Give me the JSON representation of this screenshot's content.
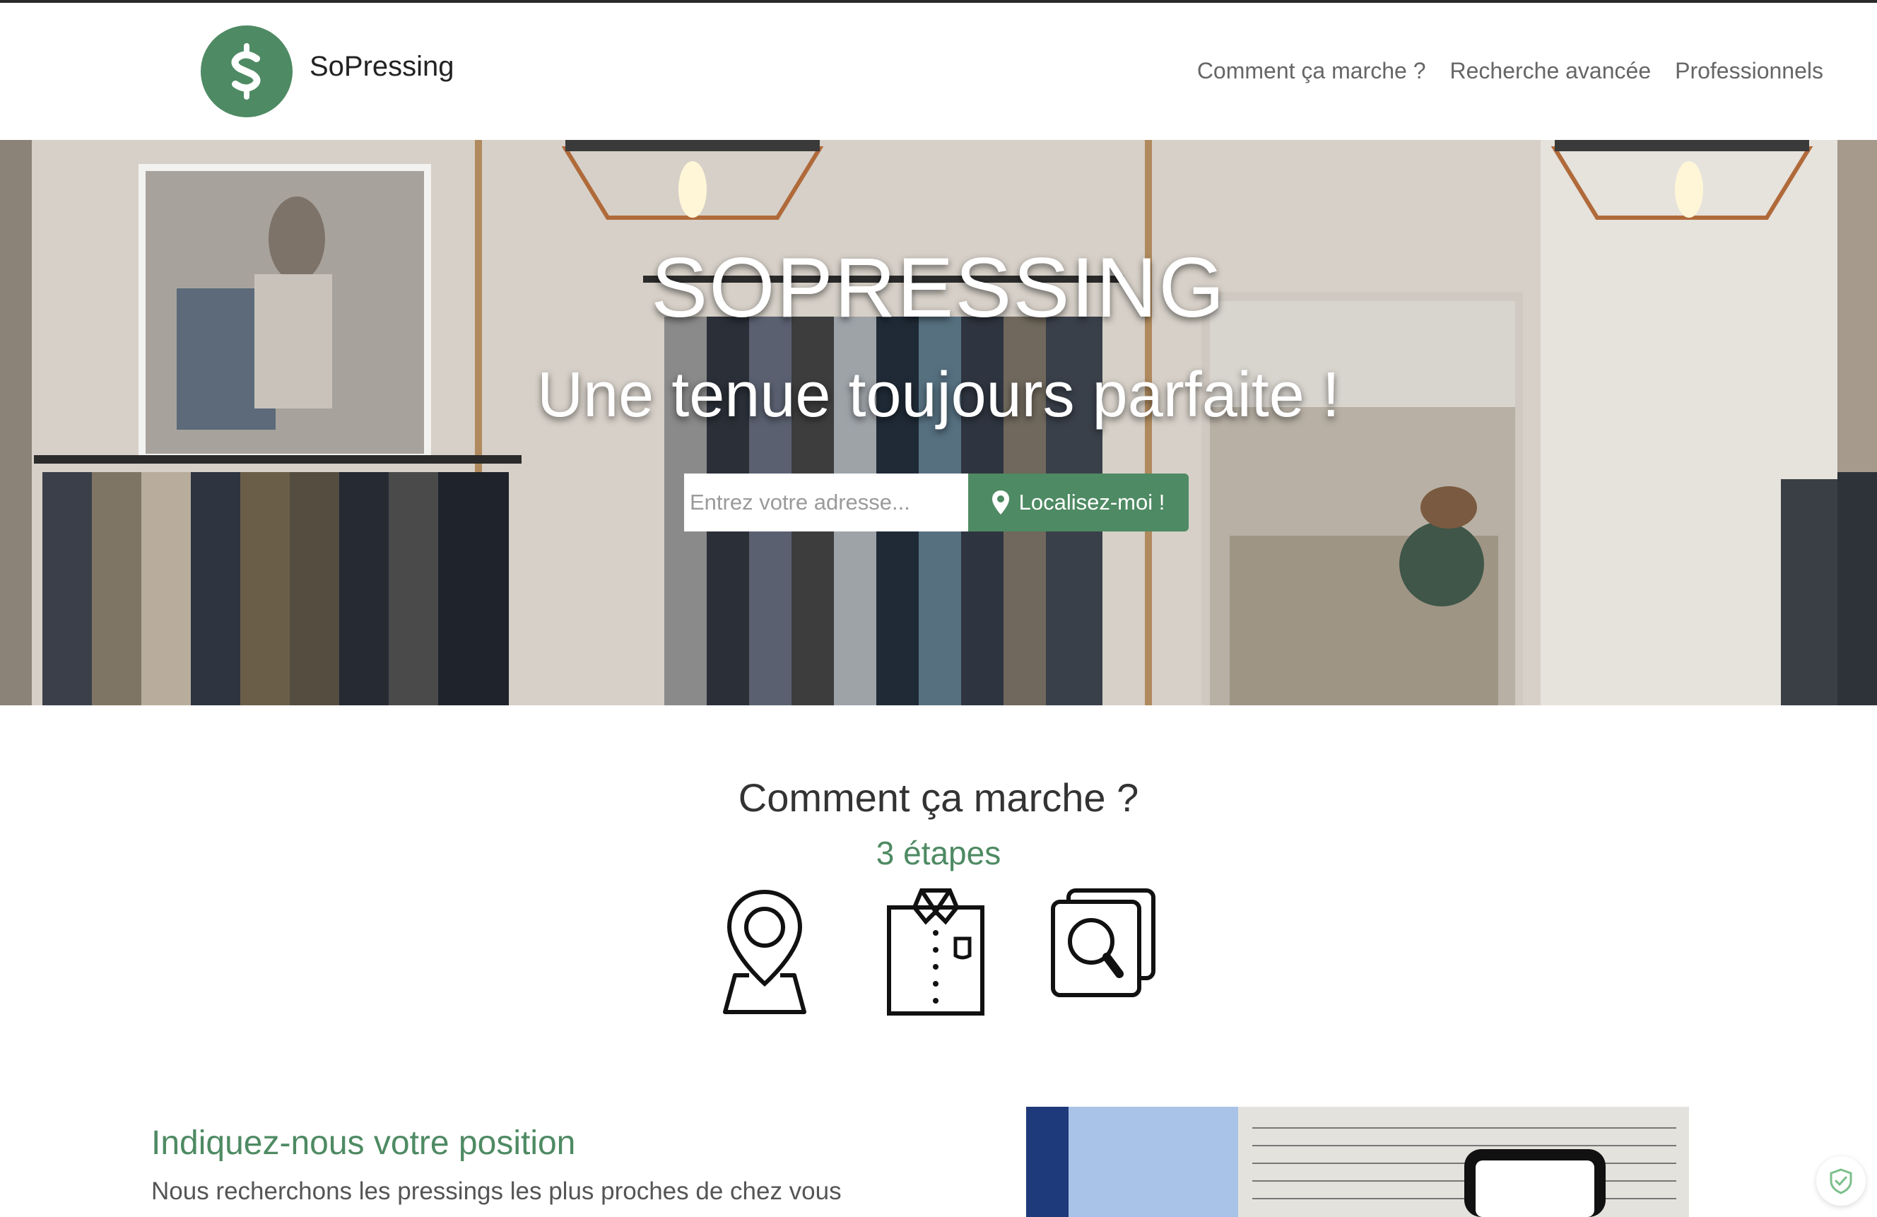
{
  "brand": {
    "name": "SoPressing",
    "logo_letter": "S",
    "accent": "#4e8a63"
  },
  "nav": [
    {
      "label": "Comment ça marche ?"
    },
    {
      "label": "Recherche avancée"
    },
    {
      "label": "Professionnels"
    }
  ],
  "hero": {
    "title": "SOPRESSING",
    "subtitle": "Une tenue toujours parfaite !",
    "search_placeholder": "Entrez votre adresse...",
    "locate_label": "Localisez-moi !",
    "locate_icon": "map-marker-icon"
  },
  "how": {
    "title": "Comment ça marche ?",
    "subtitle": "3 étapes",
    "steps": [
      {
        "icon": "location-pin-icon"
      },
      {
        "icon": "shirt-icon"
      },
      {
        "icon": "search-photos-icon"
      }
    ]
  },
  "section1": {
    "title": "Indiquez-nous votre position",
    "text": "Nous recherchons les pressings les plus proches de chez vous"
  },
  "widgets": {
    "shield_icon": "shield-check-icon"
  }
}
